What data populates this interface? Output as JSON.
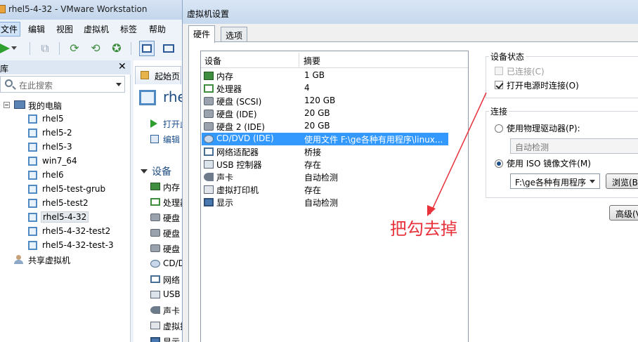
{
  "window": {
    "title": "rhel5-4-32 - VMware Workstation"
  },
  "menu": [
    "文件",
    "编辑",
    "视图",
    "虚拟机",
    "标签",
    "帮助"
  ],
  "library": {
    "title": "库",
    "search_placeholder": "在此搜索",
    "root": "我的电脑",
    "vms": [
      "rhel5",
      "rhel5-2",
      "rhel5-3",
      "win7_64",
      "rhel6",
      "rhel5-test-grub",
      "rhel5-test2",
      "rhel5-4-32",
      "rhel5-4-32-test2",
      "rhel5-4-32-test-3"
    ],
    "selected": "rhel5-4-32",
    "shared": "共享虚拟机"
  },
  "content": {
    "home_tab": "起始页",
    "vm_title": "rhel",
    "commands": [
      "打开此",
      "编辑"
    ],
    "devices_section": "设备",
    "devices": [
      "内存",
      "处理器",
      "硬盘",
      "硬盘",
      "硬盘",
      "CD/D",
      "网络",
      "USB",
      "声卡",
      "虚拟打",
      "显示"
    ]
  },
  "dialog": {
    "title": "虚拟机设置",
    "tabs": [
      "硬件",
      "选项"
    ],
    "columns": {
      "device": "设备",
      "summary": "摘要"
    },
    "hardware": [
      {
        "name": "内存",
        "summary": "1 GB",
        "icon": "memory-icon"
      },
      {
        "name": "处理器",
        "summary": "4",
        "icon": "cpu-icon"
      },
      {
        "name": "硬盘 (SCSI)",
        "summary": "120 GB",
        "icon": "disk-icon"
      },
      {
        "name": "硬盘 (IDE)",
        "summary": "20 GB",
        "icon": "disk-icon"
      },
      {
        "name": "硬盘 2 (IDE)",
        "summary": "20 GB",
        "icon": "disk-icon"
      },
      {
        "name": "CD/DVD (IDE)",
        "summary": "使用文件 F:\\ge各种有用程序\\linux...",
        "icon": "cd-icon",
        "selected": true
      },
      {
        "name": "网络适配器",
        "summary": "桥接",
        "icon": "network-icon"
      },
      {
        "name": "USB 控制器",
        "summary": "存在",
        "icon": "usb-icon"
      },
      {
        "name": "声卡",
        "summary": "自动检测",
        "icon": "sound-icon"
      },
      {
        "name": "虚拟打印机",
        "summary": "存在",
        "icon": "printer-icon"
      },
      {
        "name": "显示",
        "summary": "自动检测",
        "icon": "display-icon"
      }
    ],
    "device_status": {
      "legend": "设备状态",
      "connected": "已连接(C)",
      "connect_at_power_on": "打开电源时连接(O)"
    },
    "connection": {
      "legend": "连接",
      "physical_drive": "使用物理驱动器(P):",
      "physical_value": "自动检测",
      "iso": "使用 ISO 镜像文件(M)",
      "iso_value": "F:\\ge各种有用程序",
      "browse": "浏览(B)"
    },
    "advanced": "高级(V)"
  },
  "annotation": {
    "text": "把勾去掉",
    "color": "#e8323c"
  }
}
